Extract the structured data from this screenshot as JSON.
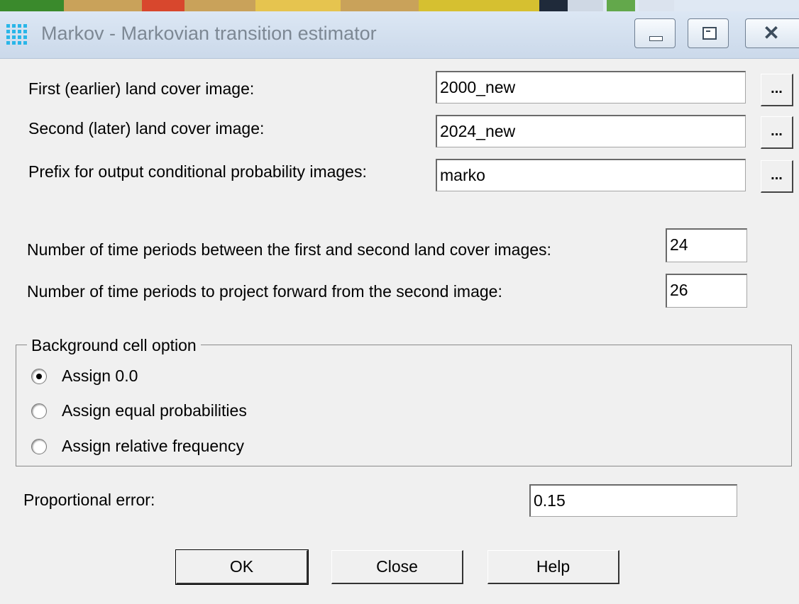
{
  "window": {
    "title": "Markov - Markovian transition estimator",
    "icon": "app-grid-icon",
    "controls": [
      "minimize-icon",
      "maximize-icon",
      "close-icon"
    ],
    "title_color": "#7d8894"
  },
  "inputs": {
    "first_image": {
      "label": "First (earlier) land cover image:",
      "value": "2000_new",
      "browse_label": "..."
    },
    "second_image": {
      "label": "Second (later) land cover image:",
      "value": "2024_new",
      "browse_label": "..."
    },
    "prefix": {
      "label": "Prefix for output conditional probability images:",
      "value": "marko",
      "browse_label": "..."
    }
  },
  "periods": {
    "between_label": "Number of time periods between the first and second land cover images:",
    "between_value": "24",
    "forward_label": "Number of time periods to project forward from the second image:",
    "forward_value": "26"
  },
  "background": {
    "legend": "Background cell option",
    "options": [
      {
        "label": "Assign 0.0",
        "checked": true
      },
      {
        "label": "Assign equal probabilities",
        "checked": false
      },
      {
        "label": "Assign relative frequency",
        "checked": false
      }
    ]
  },
  "error": {
    "label": "Proportional error:",
    "value": "0.15"
  },
  "buttons": {
    "ok": "OK",
    "close": "Close",
    "help": "Help"
  }
}
